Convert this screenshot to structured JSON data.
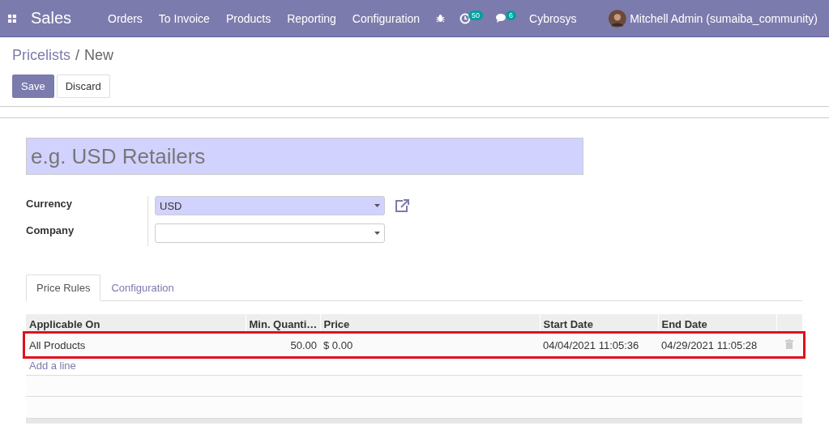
{
  "navbar": {
    "app_name": "Sales",
    "menu": [
      "Orders",
      "To Invoice",
      "Products",
      "Reporting",
      "Configuration"
    ],
    "activity_count": "50",
    "message_count": "6",
    "company": "Cybrosys",
    "user": "Mitchell Admin (sumaiba_community)"
  },
  "breadcrumb": {
    "parent": "Pricelists",
    "separator": "/",
    "current": "New"
  },
  "buttons": [
    {
      "label": "Save",
      "kind": "primary"
    },
    {
      "label": "Discard",
      "kind": "secondary"
    }
  ],
  "name_field": {
    "placeholder": "e.g. USD Retailers"
  },
  "fields": [
    {
      "label": "Currency",
      "value": "USD",
      "external_link": true
    },
    {
      "label": "Company",
      "external_link": false
    }
  ],
  "tabs": [
    {
      "label": "Price Rules",
      "selected": true
    },
    {
      "label": "Configuration",
      "selected": false
    }
  ],
  "table": {
    "columns": [
      "Applicable On",
      "Min. Quanti…",
      "Price",
      "Start Date",
      "End Date"
    ],
    "rows": [
      {
        "cells": [
          "All Products",
          "50.00",
          "$ 0.00",
          "04/04/2021 11:05:36",
          "04/29/2021 11:05:28"
        ],
        "highlighted": true
      }
    ],
    "add_line": "Add a line"
  }
}
